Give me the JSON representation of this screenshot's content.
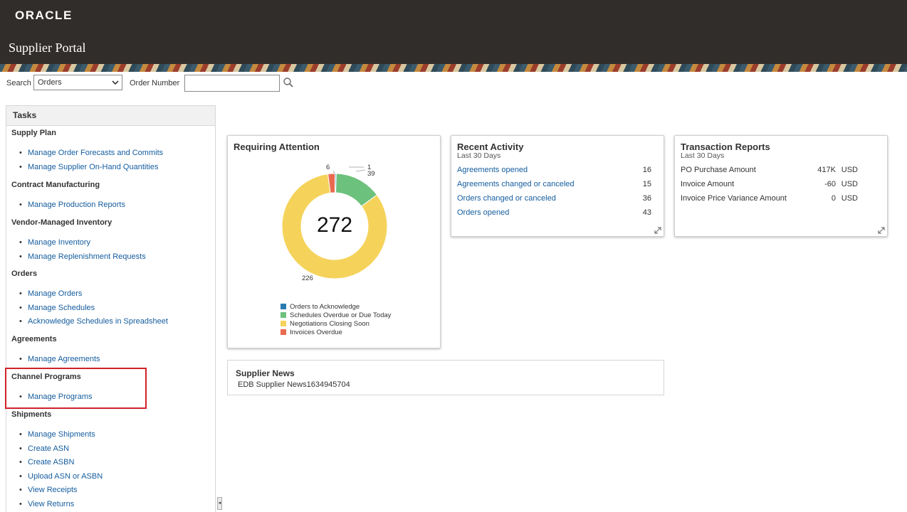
{
  "header": {
    "logo": "ORACLE",
    "title": "Supplier Portal"
  },
  "search": {
    "label": "Search",
    "selected": "Orders",
    "order_label": "Order Number",
    "order_value": ""
  },
  "tasks": {
    "title": "Tasks",
    "groups": [
      {
        "title": "Supply Plan",
        "items": [
          "Manage Order Forecasts and Commits",
          "Manage Supplier On-Hand Quantities"
        ]
      },
      {
        "title": "Contract Manufacturing",
        "items": [
          "Manage Production Reports"
        ]
      },
      {
        "title": "Vendor-Managed Inventory",
        "items": [
          "Manage Inventory",
          "Manage Replenishment Requests"
        ]
      },
      {
        "title": "Orders",
        "items": [
          "Manage Orders",
          "Manage Schedules",
          "Acknowledge Schedules in Spreadsheet"
        ]
      },
      {
        "title": "Agreements",
        "items": [
          "Manage Agreements"
        ]
      },
      {
        "title": "Channel Programs",
        "items": [
          "Manage Programs"
        ]
      },
      {
        "title": "Shipments",
        "items": [
          "Manage Shipments",
          "Create ASN",
          "Create ASBN",
          "Upload ASN or ASBN",
          "View Receipts",
          "View Returns"
        ]
      }
    ]
  },
  "requiring_attention": {
    "title": "Requiring Attention",
    "total": "272",
    "slices": [
      {
        "label": "Orders to Acknowledge",
        "value": 1,
        "display": "1",
        "color": "#2a7ab0"
      },
      {
        "label": "Schedules Overdue or Due Today",
        "value": 39,
        "display": "39",
        "color": "#6cc17c"
      },
      {
        "label": "Negotiations Closing Soon",
        "value": 226,
        "display": "226",
        "color": "#f5d35b"
      },
      {
        "label": "Invoices Overdue",
        "value": 6,
        "display": "6",
        "color": "#ea6a4f"
      }
    ]
  },
  "recent_activity": {
    "title": "Recent Activity",
    "subtitle": "Last 30 Days",
    "rows": [
      {
        "label": "Agreements opened",
        "value": "16"
      },
      {
        "label": "Agreements changed or canceled",
        "value": "15"
      },
      {
        "label": "Orders changed or canceled",
        "value": "36"
      },
      {
        "label": "Orders opened",
        "value": "43"
      }
    ]
  },
  "transaction_reports": {
    "title": "Transaction Reports",
    "subtitle": "Last 30 Days",
    "rows": [
      {
        "label": "PO Purchase Amount",
        "value": "417K",
        "currency": "USD"
      },
      {
        "label": "Invoice Amount",
        "value": "-60",
        "currency": "USD"
      },
      {
        "label": "Invoice Price Variance Amount",
        "value": "0",
        "currency": "USD"
      }
    ]
  },
  "supplier_news": {
    "title": "Supplier News",
    "body": "EDB Supplier News1634945704"
  },
  "icons": {
    "search": "magnifier-icon",
    "expand": "expand-diagonal-icon",
    "dropdown": "chevron-down-icon",
    "collapse": "caret-left-icon"
  }
}
